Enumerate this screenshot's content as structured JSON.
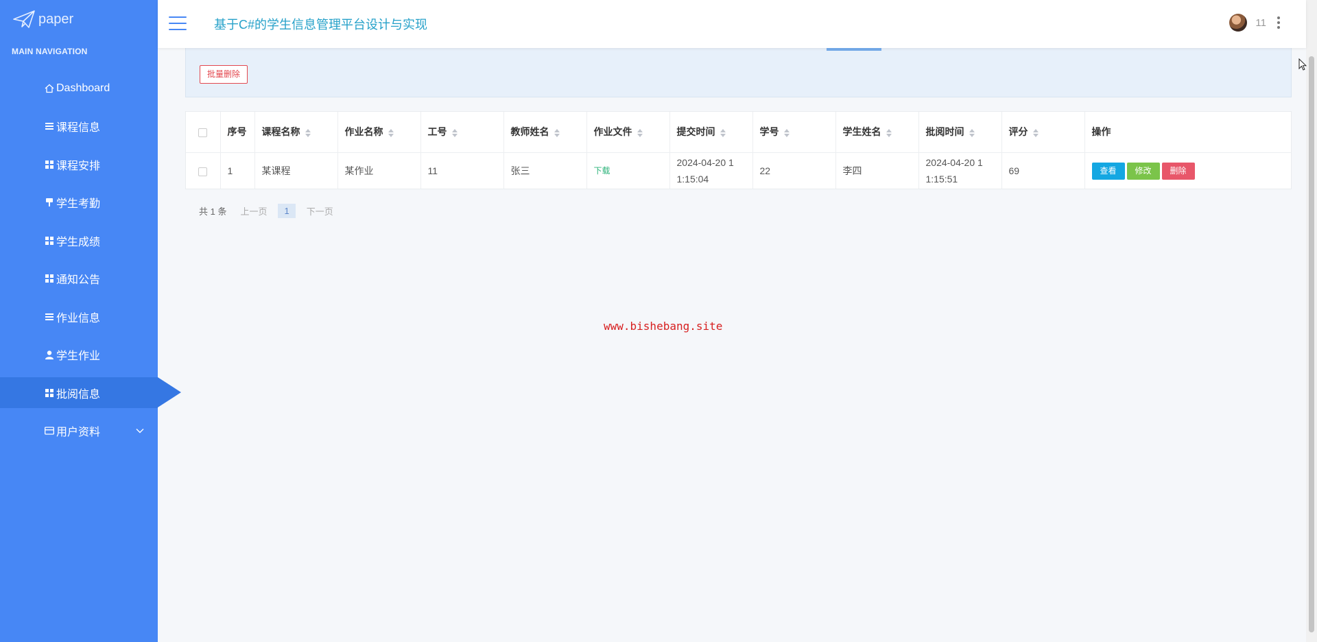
{
  "brand": {
    "logo_text": "paper"
  },
  "sidebar": {
    "heading": "MAIN NAVIGATION",
    "items": [
      {
        "label": "Dashboard",
        "icon": "home-icon"
      },
      {
        "label": "课程信息",
        "icon": "list-icon"
      },
      {
        "label": "课程安排",
        "icon": "grid-icon"
      },
      {
        "label": "学生考勤",
        "icon": "pin-icon"
      },
      {
        "label": "学生成绩",
        "icon": "grid-icon"
      },
      {
        "label": "通知公告",
        "icon": "grid-icon"
      },
      {
        "label": "作业信息",
        "icon": "list-icon"
      },
      {
        "label": "学生作业",
        "icon": "user-icon"
      },
      {
        "label": "批阅信息",
        "icon": "grid-icon",
        "active": true
      },
      {
        "label": "用户资料",
        "icon": "card-icon",
        "has_submenu": true
      }
    ]
  },
  "topbar": {
    "title": "基于C#的学生信息管理平台设计与实现",
    "username": "11"
  },
  "toolbar": {
    "batch_delete_label": "批量删除"
  },
  "table": {
    "columns": [
      "序号",
      "课程名称",
      "作业名称",
      "工号",
      "教师姓名",
      "作业文件",
      "提交时间",
      "学号",
      "学生姓名",
      "批阅时间",
      "评分",
      "操作"
    ],
    "rows": [
      {
        "index": "1",
        "course_name": "某课程",
        "homework_name": "某作业",
        "teacher_id": "11",
        "teacher_name": "张三",
        "file_link": "下载",
        "submit_time_1": "2024-04-20 1",
        "submit_time_2": "1:15:04",
        "student_id": "22",
        "student_name": "李四",
        "review_time_1": "2024-04-20 1",
        "review_time_2": "1:15:51",
        "score": "69",
        "actions": {
          "view": "查看",
          "edit": "修改",
          "delete": "删除"
        }
      }
    ]
  },
  "pagination": {
    "total": "共 1 条",
    "prev": "上一页",
    "current": "1",
    "next": "下一页"
  },
  "watermark": "www.bishebang.site",
  "colors": {
    "sidebar_bg": "#4787f5",
    "sidebar_active": "#3577e3",
    "title": "#26a1c9",
    "view_btn": "#14a7e2",
    "edit_btn": "#7bc44a",
    "delete_btn": "#e8576a",
    "watermark": "#d71f1f"
  }
}
